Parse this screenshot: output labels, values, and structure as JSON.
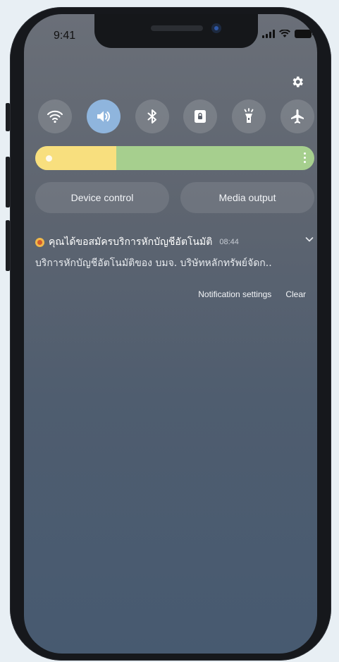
{
  "status_bar": {
    "time": "9:41"
  },
  "quick_settings": {
    "toggles": [
      {
        "icon": "wifi-icon",
        "active": false
      },
      {
        "icon": "volume-icon",
        "active": true
      },
      {
        "icon": "bluetooth-icon",
        "active": false
      },
      {
        "icon": "lock-screen-icon",
        "active": false
      },
      {
        "icon": "flashlight-icon",
        "active": false
      },
      {
        "icon": "airplane-icon",
        "active": false
      }
    ],
    "brightness_level": 0.29,
    "device_control_label": "Device control",
    "media_output_label": "Media output"
  },
  "notification": {
    "title": "คุณได้ขอสมัครบริการหักบัญชีอัตโนมัติ",
    "time": "08:44",
    "body": "บริการหักบัญชีอัตโนมัติของ บมจ. บริษัทหลักทรัพย์จัดก..",
    "settings_label": "Notification settings",
    "clear_label": "Clear"
  },
  "colors": {
    "brightness_fill": "#f8df7e",
    "brightness_track": "#a6cf8e",
    "active_toggle": "#8fb5dd"
  }
}
